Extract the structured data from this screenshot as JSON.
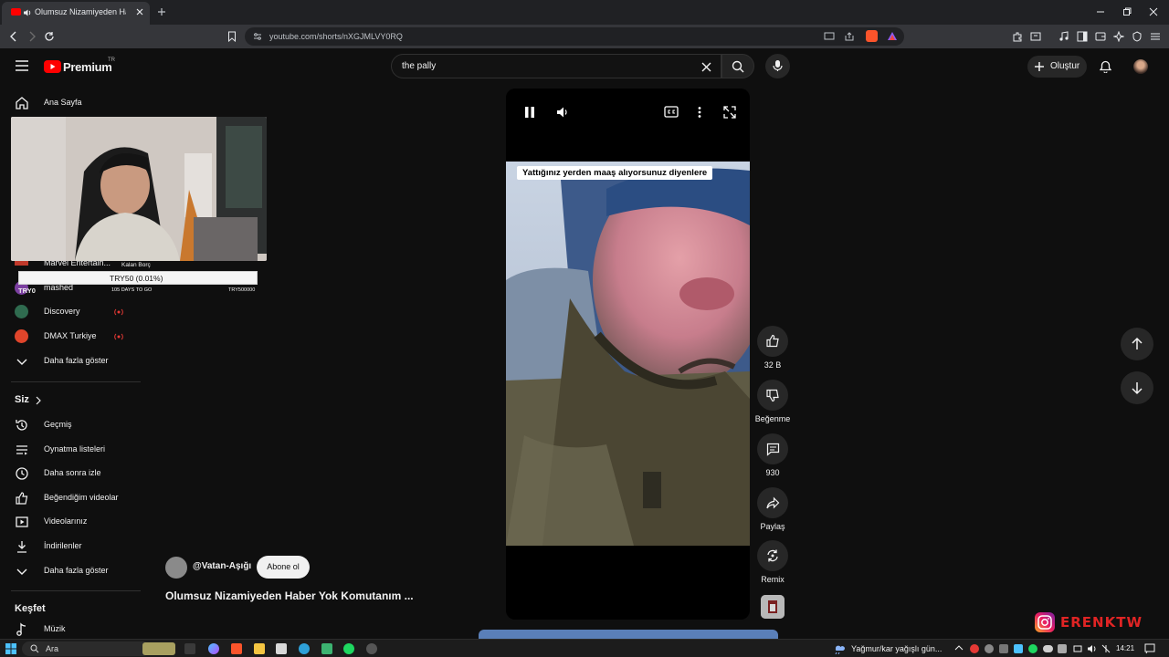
{
  "browser": {
    "tab_title": "Olumsuz Nizamiyeden Haber",
    "url": "youtube.com/shorts/nXGJMLVY0RQ"
  },
  "header": {
    "logo_text": "Premium",
    "logo_sup": "TR",
    "search_value": "the pally",
    "create_label": "Oluştur"
  },
  "sidebar": {
    "home_label": "Ana Sayfa",
    "subscriptions": [
      {
        "label": "Marvel Entertain...",
        "color": "#c0392b"
      },
      {
        "label": "mashed",
        "color": "#7b3fa0"
      },
      {
        "label": "Discovery",
        "color": "#2f6b4f"
      },
      {
        "label": "DMAX Turkiye",
        "color": "#e0452b"
      }
    ],
    "show_more_1": "Daha fazla göster",
    "you_title": "Siz",
    "you_items": [
      {
        "label": "Geçmiş",
        "icon": "history-icon"
      },
      {
        "label": "Oynatma listeleri",
        "icon": "playlists-icon"
      },
      {
        "label": "Daha sonra izle",
        "icon": "watch-later-icon"
      },
      {
        "label": "Beğendiğim videolar",
        "icon": "liked-icon"
      },
      {
        "label": "Videolarınız",
        "icon": "your-videos-icon"
      },
      {
        "label": "İndirilenler",
        "icon": "downloads-icon"
      }
    ],
    "show_more_2": "Daha fazla göster",
    "explore_title": "Keşfet",
    "explore_items": [
      {
        "label": "Müzik",
        "icon": "music-icon"
      }
    ]
  },
  "donation": {
    "remaining_label": "Kalan Borç",
    "amount": "TRY50 (0.01%)",
    "currency": "TRY0",
    "days": "105 DAYS TO GO",
    "goal": "TRY500000"
  },
  "player": {
    "caption": "Yattığınız yerden maaş alıyorsunuz diyenlere"
  },
  "actions": {
    "like_count": "32 B",
    "dislike_label": "Beğenme",
    "comment_count": "930",
    "share_label": "Paylaş",
    "remix_label": "Remix"
  },
  "video": {
    "channel_handle": "@Vatan-Aşığı",
    "subscribe_label": "Abone ol",
    "title": "Olumsuz Nizamiyeden Haber Yok Komutanım ..."
  },
  "taskbar": {
    "search_label": "Ara",
    "weather": "Yağmur/kar yağışlı gün...",
    "time": "14:21"
  },
  "watermark": {
    "text": "ERENKTW"
  }
}
